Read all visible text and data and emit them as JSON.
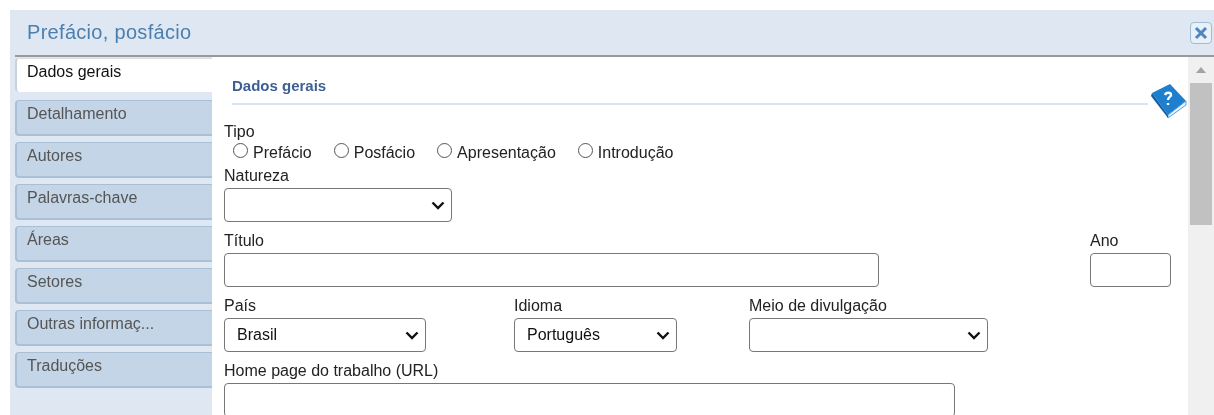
{
  "window": {
    "title": "Prefácio, posfácio"
  },
  "tabs": [
    {
      "label": "Dados gerais",
      "selected": true
    },
    {
      "label": "Detalhamento",
      "selected": false
    },
    {
      "label": "Autores",
      "selected": false
    },
    {
      "label": "Palavras-chave",
      "selected": false
    },
    {
      "label": "Áreas",
      "selected": false
    },
    {
      "label": "Setores",
      "selected": false
    },
    {
      "label": "Outras informaç...",
      "selected": false
    },
    {
      "label": "Traduções",
      "selected": false
    }
  ],
  "section": {
    "title": "Dados gerais"
  },
  "tipo": {
    "label": "Tipo",
    "options": [
      {
        "label": "Prefácio",
        "selected": false
      },
      {
        "label": "Posfácio",
        "selected": false
      },
      {
        "label": "Apresentação",
        "selected": false
      },
      {
        "label": "Introdução",
        "selected": false
      }
    ]
  },
  "natureza": {
    "label": "Natureza"
  },
  "titulo": {
    "label": "Título"
  },
  "ano": {
    "label": "Ano"
  },
  "pais": {
    "label": "País",
    "value": "Brasil"
  },
  "idioma": {
    "label": "Idioma",
    "value": "Português"
  },
  "meio": {
    "label": "Meio de divulgação"
  },
  "homepage": {
    "label": "Home page do trabalho (URL)"
  }
}
